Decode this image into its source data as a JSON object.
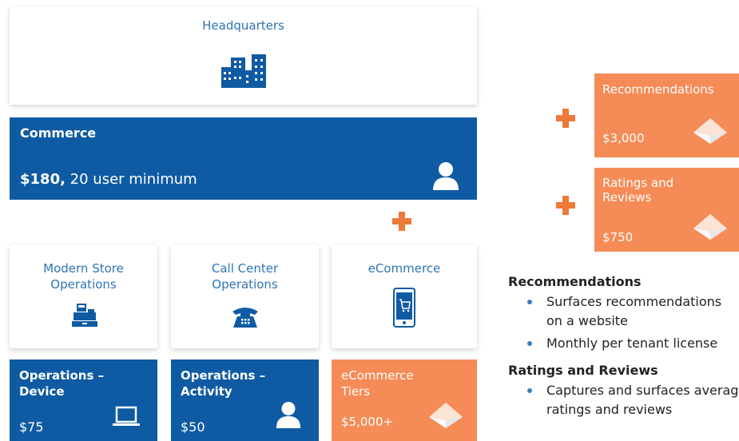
{
  "headquarters": {
    "title": "Headquarters",
    "icon": "buildings-icon"
  },
  "commerce": {
    "title": "Commerce",
    "price": "$180,",
    "note": " 20 user minimum",
    "icon": "user-icon"
  },
  "channels": [
    {
      "title": "Modern Store Operations",
      "icon": "cash-register-icon"
    },
    {
      "title": "Call Center Operations",
      "icon": "telephone-icon"
    },
    {
      "title": "eCommerce",
      "icon": "mobile-cart-icon"
    }
  ],
  "licenses": [
    {
      "title": "Operations – Device",
      "price": "$75",
      "icon": "laptop-icon",
      "color": "#0f5ba3"
    },
    {
      "title": "Operations – Activity",
      "price": "$50",
      "icon": "user-icon",
      "color": "#0f5ba3"
    },
    {
      "title": "eCommerce Tiers",
      "price": "$5,000+",
      "icon": "diamond-icon",
      "color": "#f58b56"
    }
  ],
  "addons": [
    {
      "title": "Recommendations",
      "price": "$3,000",
      "icon": "diamond-icon"
    },
    {
      "title": "Ratings and Reviews",
      "price": "$750",
      "icon": "diamond-icon"
    }
  ],
  "details": {
    "recommendations": {
      "heading": "Recommendations",
      "bullets": [
        "Surfaces recommendations on a website",
        "Monthly per tenant license"
      ]
    },
    "ratings": {
      "heading": "Ratings and Reviews",
      "bullets": [
        "Captures and surfaces average ratings and reviews"
      ]
    }
  },
  "colors": {
    "blue": "#0f5ba3",
    "orange": "#f58b56",
    "plus": "#ee7a3a",
    "title_blue": "#2e74b5"
  }
}
